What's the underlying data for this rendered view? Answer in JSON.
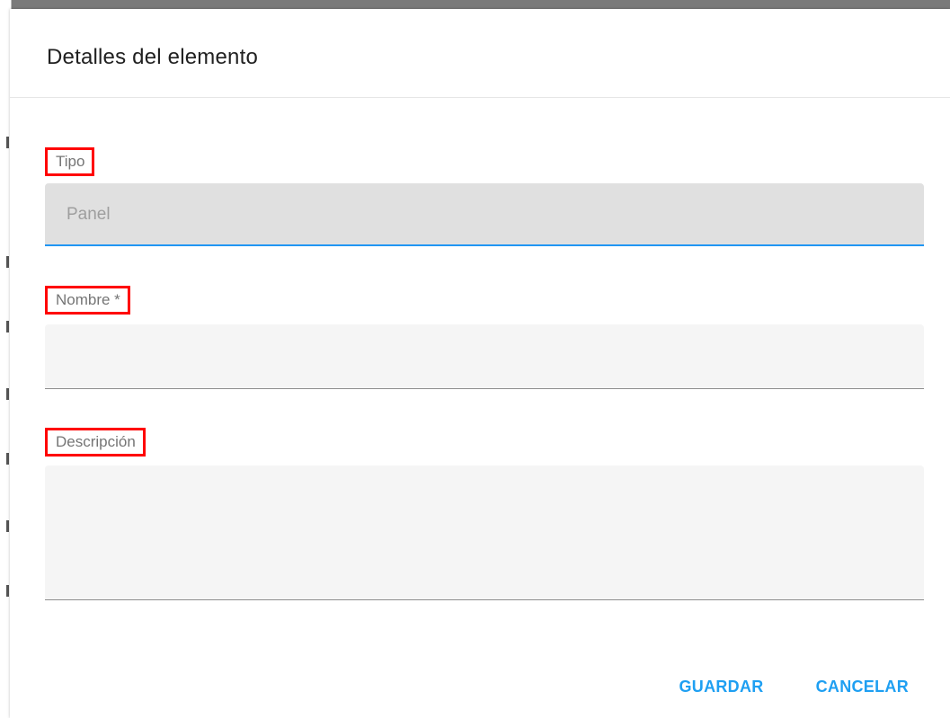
{
  "dialog": {
    "title": "Detalles del elemento"
  },
  "fields": {
    "tipo": {
      "label": "Tipo",
      "value": "Panel"
    },
    "nombre": {
      "label": "Nombre *",
      "value": ""
    },
    "descripcion": {
      "label": "Descripción",
      "value": ""
    }
  },
  "actions": {
    "save_label": "GUARDAR",
    "cancel_label": "CANCELAR"
  },
  "colors": {
    "accent": "#1e9ff2",
    "highlight": "#ff0000",
    "field_bg": "#f5f5f5",
    "disabled_bg": "#e0e0e0"
  }
}
